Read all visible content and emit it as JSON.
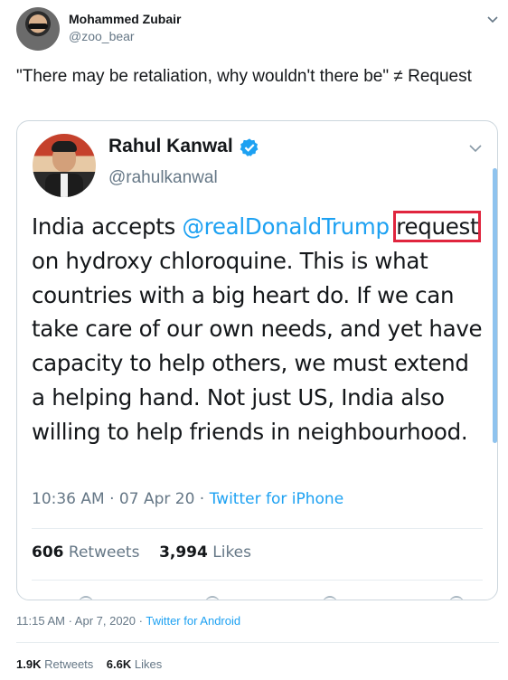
{
  "tweet": {
    "author_name": "Mohammed Zubair",
    "author_handle": "@zoo_bear",
    "text": "\"There may be retaliation, why wouldn't there be\"  ≠ Request",
    "time": "11:15 AM · Apr 7, 2020",
    "separator": " · ",
    "source": "Twitter for Android",
    "retweets_count": "1.9K",
    "retweets_label": "Retweets",
    "likes_count": "6.6K",
    "likes_label": "Likes"
  },
  "quoted": {
    "author_name": "Rahul Kanwal",
    "author_handle": "@rahulkanwal",
    "text_prefix": "India accepts ",
    "mention": "@realDonaldTrump",
    "highlight_word": "request",
    "text_suffix": " on hydroxy chloroquine. This is what countries with a big heart do. If we can take care of our own needs, and yet have capacity to help others, we must extend a helping hand. Not just US, India also willing to help friends in neighbourhood.",
    "time": "10:36 AM · 07 Apr 20",
    "separator": " · ",
    "source": "Twitter for iPhone",
    "retweets_count": "606",
    "retweets_label": "Retweets",
    "likes_count": "3,994",
    "likes_label": "Likes"
  },
  "icons": [
    "chevron-down-icon",
    "verified-badge-icon",
    "avatar",
    "reply-icon",
    "retweet-icon",
    "like-icon",
    "share-icon"
  ],
  "colors": {
    "link": "#1da1f2",
    "secondary": "#657786",
    "highlight_box": "#e0253e",
    "verified": "#1da1f2"
  }
}
